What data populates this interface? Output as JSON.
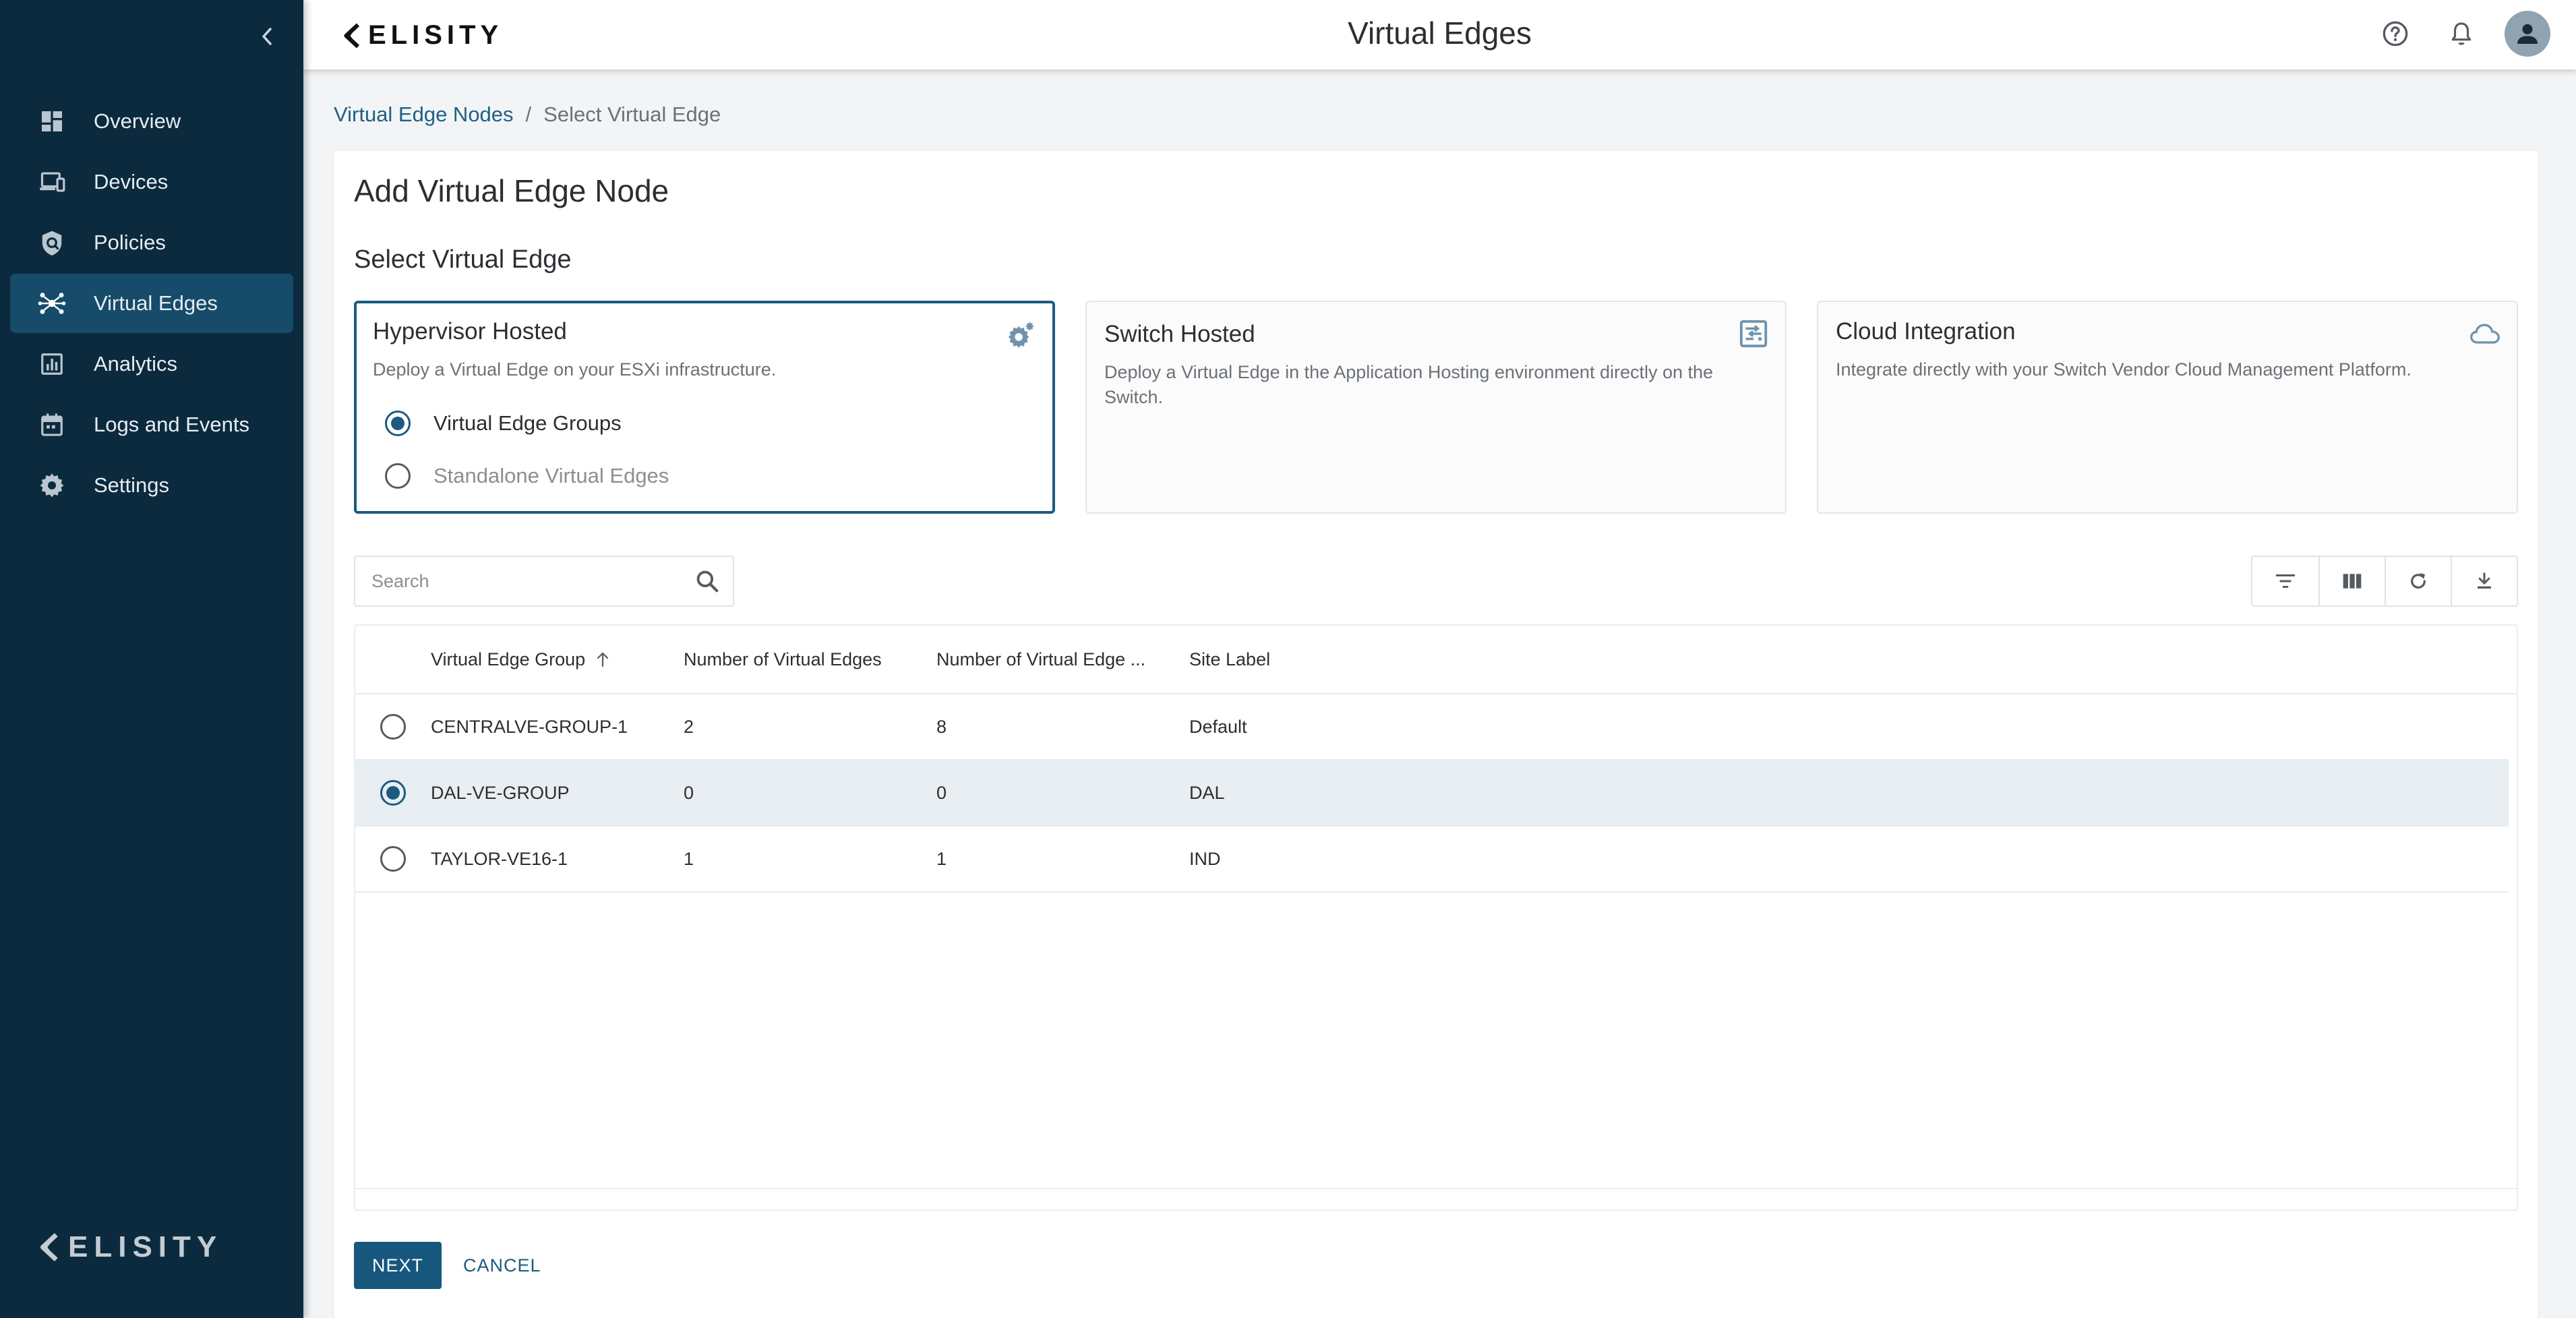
{
  "app": {
    "brand": "ELISITY",
    "page_title": "Virtual Edges"
  },
  "sidebar": {
    "items": [
      {
        "label": "Overview",
        "icon": "dashboard-icon"
      },
      {
        "label": "Devices",
        "icon": "devices-icon"
      },
      {
        "label": "Policies",
        "icon": "shield-icon"
      },
      {
        "label": "Virtual Edges",
        "icon": "network-icon",
        "active": true
      },
      {
        "label": "Analytics",
        "icon": "chart-icon"
      },
      {
        "label": "Logs and Events",
        "icon": "calendar-icon"
      },
      {
        "label": "Settings",
        "icon": "gear-icon"
      }
    ],
    "footer_brand": "ELISITY"
  },
  "breadcrumb": {
    "parent": "Virtual Edge Nodes",
    "separator": "/",
    "current": "Select Virtual Edge"
  },
  "form": {
    "title": "Add Virtual Edge Node",
    "section_title": "Select Virtual Edge",
    "options": [
      {
        "title": "Hypervisor Hosted",
        "description": "Deploy a Virtual Edge on your ESXi infrastructure.",
        "selected": true,
        "sub_options": [
          {
            "label": "Virtual Edge Groups",
            "checked": true
          },
          {
            "label": "Standalone Virtual Edges",
            "checked": false
          }
        ]
      },
      {
        "title": "Switch Hosted",
        "description": "Deploy a Virtual Edge in the Application Hosting environment directly on the Switch.",
        "selected": false
      },
      {
        "title": "Cloud Integration",
        "description": "Integrate directly with your Switch Vendor Cloud Management Platform.",
        "selected": false
      }
    ]
  },
  "search": {
    "placeholder": "Search",
    "value": ""
  },
  "table": {
    "columns": [
      "Virtual Edge Group",
      "Number of Virtual Edges",
      "Number of Virtual Edge ...",
      "Site Label"
    ],
    "sort": {
      "column": "Virtual Edge Group",
      "direction": "asc"
    },
    "rows": [
      {
        "group": "CENTRALVE-GROUP-1",
        "num_edges": "2",
        "num_edge_other": "8",
        "site": "Default",
        "selected": false
      },
      {
        "group": "DAL-VE-GROUP",
        "num_edges": "0",
        "num_edge_other": "0",
        "site": "DAL",
        "selected": true
      },
      {
        "group": "TAYLOR-VE16-1",
        "num_edges": "1",
        "num_edge_other": "1",
        "site": "IND",
        "selected": false
      }
    ]
  },
  "actions": {
    "next": "NEXT",
    "cancel": "CANCEL"
  },
  "colors": {
    "sidebar_bg": "#0c2a3e",
    "sidebar_active": "#174b6a",
    "primary": "#17577d",
    "selected_row": "#e8eef1"
  }
}
